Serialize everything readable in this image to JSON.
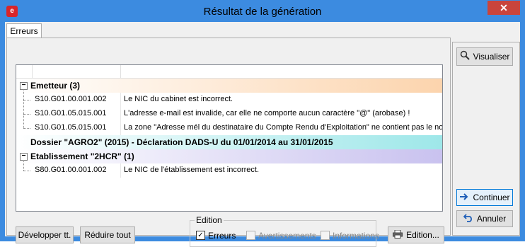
{
  "window": {
    "title": "Résultat de la génération",
    "close_label": "✕"
  },
  "tabs": [
    {
      "label": "Erreurs"
    }
  ],
  "tree": {
    "groups": [
      {
        "label": "Emetteur (3)",
        "rows": [
          {
            "code": "S10.G01.00.001.002",
            "message": "Le NIC du cabinet est incorrect."
          },
          {
            "code": "S10.G01.05.015.001",
            "message": "L'adresse e-mail est invalide, car elle ne comporte aucun caractère \"@\" (arobase) !"
          },
          {
            "code": "S10.G01.05.015.001",
            "message": "La zone \"Adresse mél du destinataire du Compte Rendu d'Exploitation\" ne contient pas le nom"
          }
        ]
      },
      {
        "label": "Dossier \"AGRO2\" (2015) - Déclaration DADS-U du 01/01/2014 au 31/01/2015",
        "rows": []
      },
      {
        "label": "Etablissement \"2HCR\" (1)",
        "rows": [
          {
            "code": "S80.G01.00.001.002",
            "message": "Le NIC de l'établissement est incorrect."
          }
        ]
      }
    ]
  },
  "buttons": {
    "expand_all": "Développer tt.",
    "collapse_all": "Réduire tout",
    "edition": "Edition...",
    "visualize": "Visualiser",
    "continue": "Continuer",
    "cancel": "Annuler"
  },
  "edition_group": {
    "legend": "Edition",
    "errors": {
      "label": "Erreurs",
      "checked": true
    },
    "warnings": {
      "label": "Avertissements",
      "checked": false
    },
    "info": {
      "label": "Informations",
      "checked": false
    }
  }
}
